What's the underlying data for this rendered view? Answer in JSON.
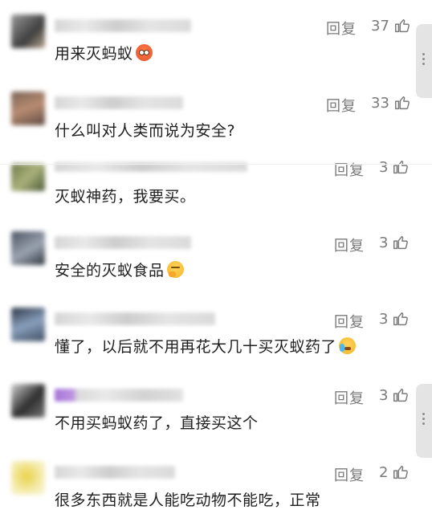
{
  "comments": [
    {
      "reply_label": "回复",
      "likes": "37",
      "text": "用来灭蚂蚁",
      "emoji": "angry-face-emoji",
      "avatar_color": "#6b6b6b"
    },
    {
      "reply_label": "回复",
      "likes": "33",
      "text": "什么叫对人类而说为安全?",
      "emoji": "",
      "avatar_color": "#8a6a5a"
    },
    {
      "reply_label": "回复",
      "likes": "3",
      "text": "灭蚁神药，我要买。",
      "emoji": "",
      "avatar_color": "#7d8a5a"
    },
    {
      "reply_label": "回复",
      "likes": "3",
      "text": "安全的灭蚁食品",
      "emoji": "thinking-face-emoji",
      "avatar_color": "#5a6070"
    },
    {
      "reply_label": "回复",
      "likes": "3",
      "text": "懂了，以后就不用再花大几十买灭蚁药了",
      "emoji": "crying-laughing-emoji",
      "avatar_color": "#3d4a5e"
    },
    {
      "reply_label": "回复",
      "likes": "3",
      "text": "不用买蚂蚁药了，直接买这个",
      "emoji": "",
      "avatar_color": "#4a4a4a"
    },
    {
      "reply_label": "回复",
      "likes": "2",
      "text": "很多东西就是人能吃动物不能吃，正常",
      "emoji": "",
      "avatar_color": "#e8d86a"
    }
  ],
  "icons": {
    "like": "thumbs-up-icon",
    "scroll": "more-vertical-icon"
  }
}
